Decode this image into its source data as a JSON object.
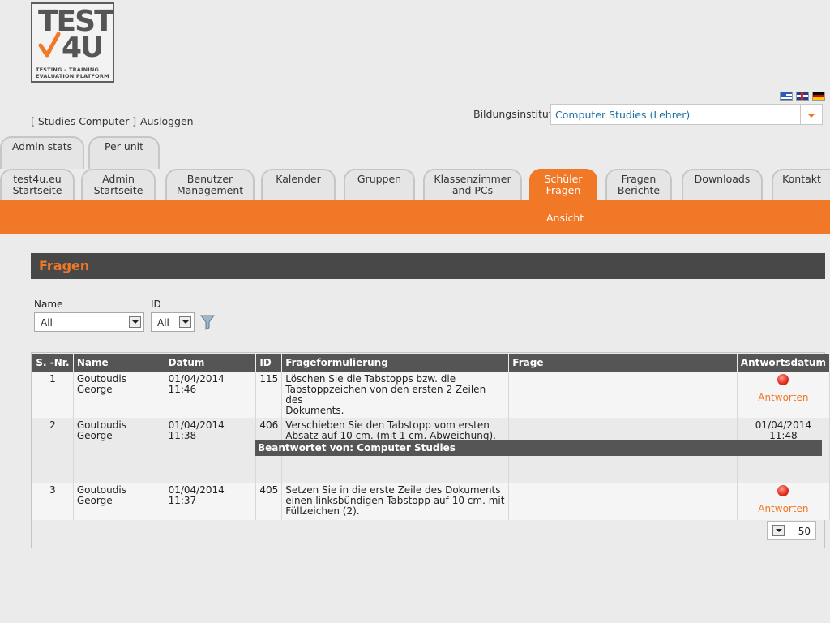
{
  "logo": {
    "line1": "TEST",
    "line2": "4U",
    "tagline": "TESTING – TRAINING EVALUATION PLATFORM"
  },
  "languages": [
    "greek-flag-icon",
    "english-flag-icon",
    "german-flag-icon"
  ],
  "header": {
    "user_link": "[ Studies Computer ]",
    "logout": "Ausloggen",
    "institute_label": "Bildungsinstitut:",
    "institute_value": "Computer Studies (Lehrer)"
  },
  "tabs_row1": [
    "Admin stats",
    "Per unit"
  ],
  "tabs_row2": [
    {
      "l1": "test4u.eu",
      "l2": "Startseite"
    },
    {
      "l1": "Admin",
      "l2": "Startseite"
    },
    {
      "l1": "Benutzer",
      "l2": "Management"
    },
    {
      "l1": "Kalender",
      "l2": ""
    },
    {
      "l1": "Gruppen",
      "l2": ""
    },
    {
      "l1": "Klassenzimmer",
      "l2": "and PCs"
    },
    {
      "l1": "Schüler",
      "l2": "Fragen"
    },
    {
      "l1": "Fragen",
      "l2": "Berichte"
    },
    {
      "l1": "Downloads",
      "l2": ""
    },
    {
      "l1": "Kontakt",
      "l2": ""
    }
  ],
  "subnav": {
    "ansicht": "Ansicht"
  },
  "section": {
    "title": "Fragen"
  },
  "filters": {
    "name_label": "Name",
    "name_value": "All",
    "id_label": "ID",
    "id_value": "All"
  },
  "table": {
    "headers": [
      "S. -Nr.",
      "Name",
      "Datum",
      "ID",
      "Frageformulierung",
      "Frage",
      "Antwortsdatum"
    ],
    "rows": [
      {
        "nr": "1",
        "name": "Goutoudis George",
        "datum": "01/04/2014 11:46",
        "id": "115",
        "formulierung_lines": [
          "Löschen Sie die Tabstopps bzw. die",
          "Tabstoppzeichen von den ersten 2 Zeilen des",
          "Dokuments."
        ],
        "frage": "",
        "antwort": "Antworten"
      },
      {
        "nr": "2",
        "name": "Goutoudis George",
        "datum": "01/04/2014 11:38",
        "id": "406",
        "formulierung_lines": [
          "Verschieben Sie den Tabstopp vom ersten",
          "Absatz auf 10 cm. (mit 1 cm. Abweichung)."
        ],
        "frage": "",
        "antwort_lines": [
          "01/04/2014",
          "11:48"
        ]
      },
      {
        "nr": "3",
        "name": "Goutoudis George",
        "datum": "01/04/2014 11:37",
        "id": "405",
        "formulierung_lines": [
          "Setzen Sie in die erste Zeile des Dokuments",
          "einen linksbündigen Tabstopp auf 10 cm. mit",
          "Füllzeichen (2)."
        ],
        "frage": "",
        "antwort": "Antworten"
      }
    ],
    "answered_by": "Beantwortet von: Computer Studies"
  },
  "pager": {
    "page_size": "50"
  },
  "colors": {
    "accent": "#f07826",
    "header_dark": "#484848"
  }
}
